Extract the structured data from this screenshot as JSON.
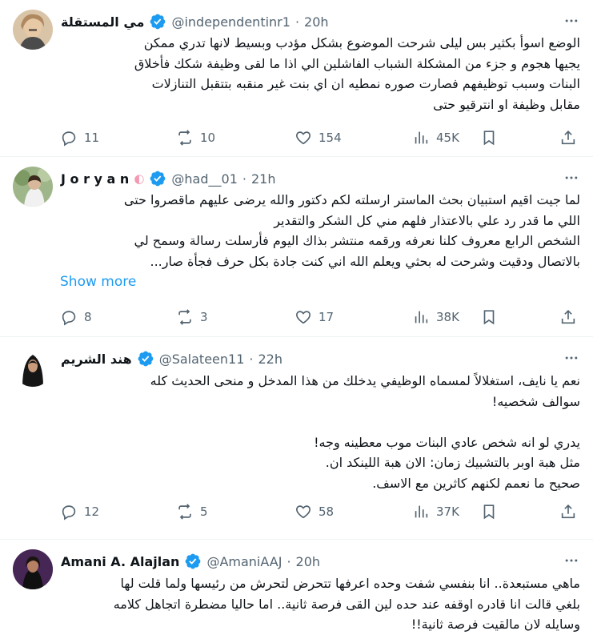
{
  "tweets": [
    {
      "name": "مي المستقلة",
      "handle": "@independentinr1",
      "dot": "·",
      "time": "20h",
      "text": "الوضع اسوأ بكثير بس ليلى شرحت الموضوع بشكل مؤدب وبسيط لانها تدري ممكن\nيجيها هجوم و جزء من المشكلة الشباب الفاشلين الي اذا ما لقى وظيفة شكك فأخلاق\nالبنات وسبب توظيفهم فصارت صوره نمطيه ان اي بنت غير منقبه بتتقبل التنازلات\nمقابل وظيفة او انترقيو حتى",
      "show_more": "",
      "replies": "11",
      "reposts": "10",
      "likes": "154",
      "views": "45K"
    },
    {
      "name": "J o r y a n",
      "handle": "@had__01",
      "dot": "·",
      "time": "21h",
      "text": "لما جيت اقيم استبيان بحث الماستر ارسلته لكم دكتور والله يرضى عليهم ماقصروا حتى\nاللي ما قدر رد علي بالاعتذار فلهم مني كل الشكر والتقدير\nالشخص الرابع معروف كلنا نعرفه ورقمه منتشر بذاك اليوم فأرسلت رسالة وسمح لي\nبالاتصال ودقيت وشرحت له بحثي ويعلم الله اني كنت جادة بكل حرف فجأة صار...",
      "show_more": "Show more",
      "replies": "8",
      "reposts": "3",
      "likes": "17",
      "views": "38K"
    },
    {
      "name": "هند الشريم",
      "handle": "@Salateen11",
      "dot": "·",
      "time": "22h",
      "text": "نعم يا نايف، استغلالاً لمسماه الوظيفي يدخلك من هذا المدخل و منحى الحديث كله\nسوالف شخصيه!\n\nيدري لو انه شخص عادي البنات موب معطينه وجه!\nمثل هبة اوبر بالتشبيك زمان: الان هبة اللينكد ان.\nصحيح ما نعمم لكنهم كاثرين مع الاسف.",
      "show_more": "",
      "replies": "12",
      "reposts": "5",
      "likes": "58",
      "views": "37K"
    },
    {
      "name": "Amani A. Alajlan",
      "handle": "@AmaniAAJ",
      "dot": "·",
      "time": "20h",
      "text": "ماهي مستبعدة.. انا بنفسي شفت وحده اعرفها تتحرض لتحرش من رئيسها ولما قلت لها\nبلغي قالت انا قادره اوقفه عند حده لين القى فرصة ثانية.. اما حاليا مضطرة اتجاهل كلامه\nوسايله لان مالقيت فرصة ثانية!!",
      "show_more": "",
      "replies": "",
      "reposts": "",
      "likes": "",
      "views": ""
    }
  ],
  "icons": {
    "verified": "verified-badge-icon",
    "more": "more-dots-icon",
    "reply": "reply-icon",
    "repost": "repost-icon",
    "like": "heart-icon",
    "views": "views-chart-icon",
    "bookmark": "bookmark-icon",
    "share": "share-icon"
  },
  "colors": {
    "accent": "#1d9bf0",
    "secondary_text": "#536471",
    "divider": "#eff3f4"
  }
}
